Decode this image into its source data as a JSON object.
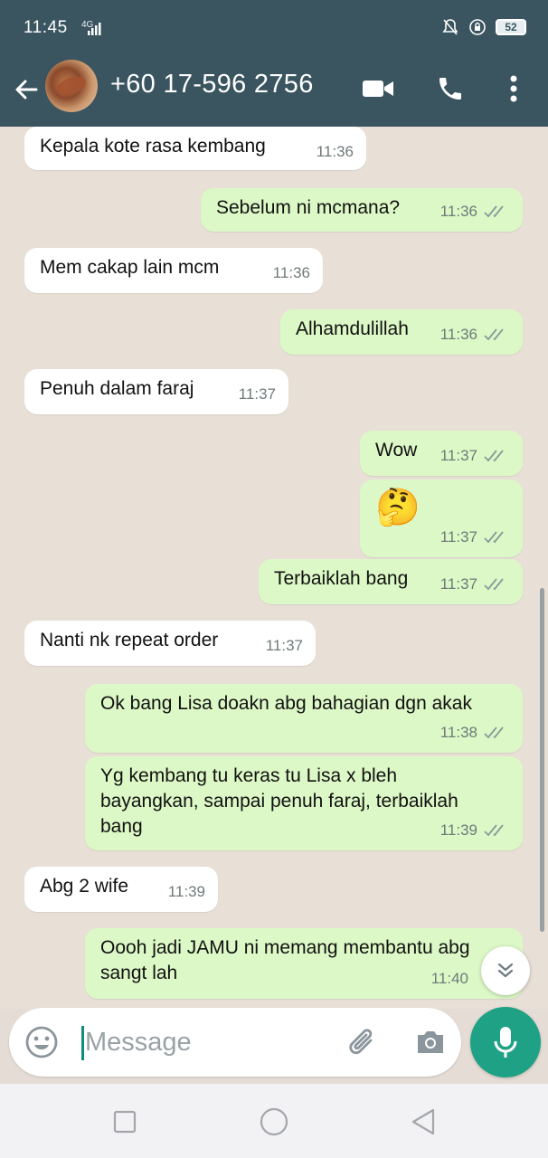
{
  "status_bar": {
    "time": "11:45",
    "network": "4G",
    "battery": "52"
  },
  "header": {
    "contact_name": "+60 17-596 2756",
    "icons": [
      "back-arrow-icon",
      "video-call-icon",
      "voice-call-icon",
      "more-options-icon"
    ]
  },
  "messages": [
    {
      "direction": "in",
      "text": "Kepala kote rasa kembang",
      "time": "11:36"
    },
    {
      "direction": "out",
      "text": "Sebelum ni mcmana?",
      "time": "11:36",
      "status": "read"
    },
    {
      "direction": "in",
      "text": "Mem cakap lain mcm",
      "time": "11:36"
    },
    {
      "direction": "out",
      "text": "Alhamdulillah",
      "time": "11:36",
      "status": "read"
    },
    {
      "direction": "in",
      "text": "Penuh dalam faraj",
      "time": "11:37"
    },
    {
      "direction": "out",
      "text": "Wow",
      "time": "11:37",
      "status": "read"
    },
    {
      "direction": "out",
      "text": "🤔",
      "time": "11:37",
      "status": "read"
    },
    {
      "direction": "out",
      "text": "Terbaiklah bang",
      "time": "11:37",
      "status": "read"
    },
    {
      "direction": "in",
      "text": "Nanti nk repeat order",
      "time": "11:37"
    },
    {
      "direction": "out",
      "text": "Ok bang Lisa doakn abg bahagian dgn akak",
      "time": "11:38",
      "status": "read"
    },
    {
      "direction": "out",
      "text": "Yg kembang tu keras tu Lisa x bleh bayangkan, sampai penuh faraj, terbaiklah bang",
      "time": "11:39",
      "status": "read"
    },
    {
      "direction": "in",
      "text": "Abg 2 wife",
      "time": "11:39"
    },
    {
      "direction": "out",
      "text": "Oooh jadi JAMU ni memang membantu abg sangt lah",
      "time": "11:40",
      "status": "sent"
    }
  ],
  "composer": {
    "placeholder": "Message"
  },
  "colors": {
    "header_bg": "#3a5560",
    "incoming_bubble": "#ffffff",
    "outgoing_bubble": "#dcf8c6",
    "accent": "#1fa185",
    "read_tick": "#8a9a9a"
  }
}
